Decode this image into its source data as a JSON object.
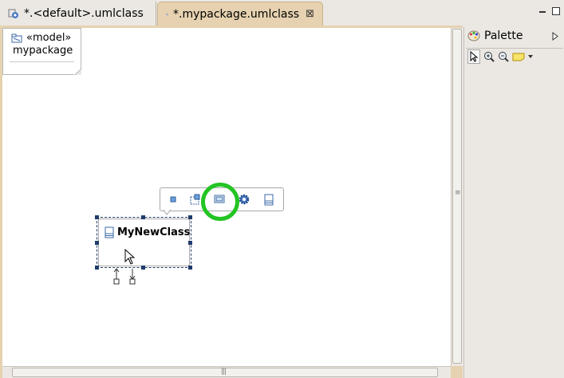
{
  "tabs": [
    {
      "label": "*.<default>.umlclass",
      "active": false
    },
    {
      "label": "*.mypackage.umlclass",
      "active": true
    }
  ],
  "tab_close_glyph": "⊠",
  "package": {
    "stereotype": "«model»",
    "name": "mypackage"
  },
  "class_node": {
    "name": "MyNewClass"
  },
  "popup_toolbar": {
    "buttons": [
      "add-attribute-icon",
      "add-operation-icon",
      "add-nested-class-icon",
      "add-gear-icon",
      "add-class-icon"
    ],
    "highlight_color": "#23c423"
  },
  "palette": {
    "title": "Palette"
  },
  "colors": {
    "editor_frame": "#e6d2b0",
    "selection": "#1f3c6b",
    "highlight": "#23c423"
  }
}
